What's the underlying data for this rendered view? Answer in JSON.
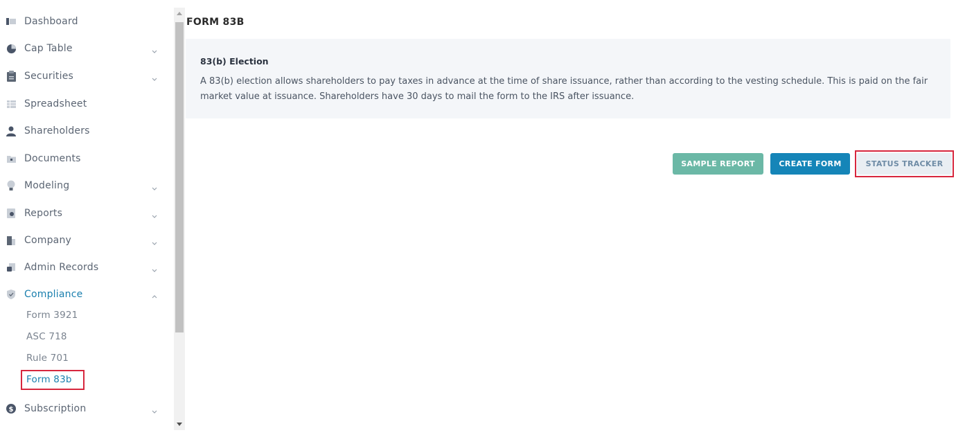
{
  "sidebar": {
    "items": [
      {
        "label": "Dashboard"
      },
      {
        "label": "Cap Table"
      },
      {
        "label": "Securities"
      },
      {
        "label": "Spreadsheet"
      },
      {
        "label": "Shareholders"
      },
      {
        "label": "Documents"
      },
      {
        "label": "Modeling"
      },
      {
        "label": "Reports"
      },
      {
        "label": "Company"
      },
      {
        "label": "Admin Records"
      },
      {
        "label": "Compliance"
      },
      {
        "label": "Subscription"
      }
    ],
    "compliance_sub": [
      {
        "label": "Form 3921"
      },
      {
        "label": "ASC 718"
      },
      {
        "label": "Rule 701"
      },
      {
        "label": "Form 83b"
      }
    ]
  },
  "main": {
    "title": "FORM 83B",
    "card": {
      "title": "83(b) Election",
      "body": "A 83(b) election allows shareholders to pay taxes in advance at the time of share issuance, rather than according to the vesting schedule. This is paid on the fair market value at issuance. Shareholders have 30 days to mail the form to the IRS after issuance."
    },
    "buttons": {
      "sample_report": "SAMPLE REPORT",
      "create_form": "CREATE FORM",
      "status_tracker": "STATUS TRACKER"
    }
  },
  "colors": {
    "accent": "#1a7fae",
    "sample_button": "#6bb8a6",
    "create_button": "#1585b8",
    "highlight": "#d7263d"
  }
}
